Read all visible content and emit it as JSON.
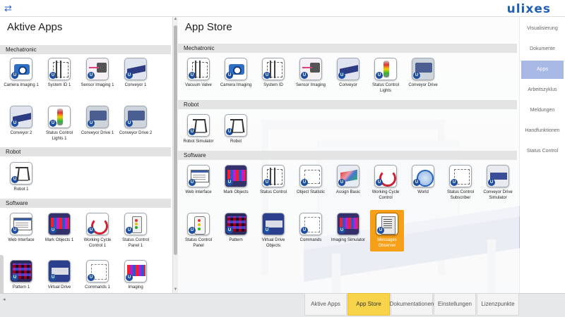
{
  "logo": "ulixes",
  "left_panel": {
    "title": "Aktive Apps",
    "sections": [
      {
        "header": "Mechatronic",
        "items": [
          {
            "label": "Camera Imaging 1",
            "icon": "camera-icon"
          },
          {
            "label": "System ID 1",
            "icon": "system-icon"
          },
          {
            "label": "Sensor Imaging 1",
            "icon": "sensor-icon"
          },
          {
            "label": "Conveyor 1",
            "icon": "conveyor-icon"
          },
          {
            "label": "Conveyor 2",
            "icon": "conveyor-icon"
          },
          {
            "label": "Status Control Lights 1",
            "icon": "lights-icon"
          },
          {
            "label": "Conveyor Drive 1",
            "icon": "drive-icon"
          },
          {
            "label": "Conveyor Drive 2",
            "icon": "drive-icon"
          }
        ]
      },
      {
        "header": "Robot",
        "items": [
          {
            "label": "Robot 1",
            "icon": "robot-icon"
          }
        ]
      },
      {
        "header": "Software",
        "items": [
          {
            "label": "Web Interface",
            "icon": "web-icon"
          },
          {
            "label": "Mark Objects 1",
            "icon": "mark-icon"
          },
          {
            "label": "Working Cycle Control 1",
            "icon": "cycle-icon"
          },
          {
            "label": "Status Control Panel 1",
            "icon": "panel-icon"
          },
          {
            "label": "Pattern 1",
            "icon": "pattern-icon"
          },
          {
            "label": "Virtual Drive",
            "icon": "vdrive-icon"
          },
          {
            "label": "Commands 1",
            "icon": "commands-icon"
          },
          {
            "label": "Imaging",
            "icon": "imaging-icon"
          }
        ]
      }
    ]
  },
  "right_panel": {
    "title": "App Store",
    "sections": [
      {
        "header": "Mechatronic",
        "items": [
          {
            "label": "Vacuum Valve",
            "icon": "valve-icon"
          },
          {
            "label": "Camera Imaging",
            "icon": "camera-icon"
          },
          {
            "label": "System ID",
            "icon": "system-icon"
          },
          {
            "label": "Sensor Imaging",
            "icon": "sensor-icon"
          },
          {
            "label": "Conveyor",
            "icon": "conveyor-icon"
          },
          {
            "label": "Status Control Lights",
            "icon": "lights-icon"
          },
          {
            "label": "Conveyor Drive",
            "icon": "drive-icon"
          }
        ]
      },
      {
        "header": "Robot",
        "items": [
          {
            "label": "Robot Simulator",
            "icon": "robot-icon"
          },
          {
            "label": "Robot",
            "icon": "robot-icon"
          }
        ]
      },
      {
        "header": "Software",
        "items": [
          {
            "label": "Web Interface",
            "icon": "web-icon"
          },
          {
            "label": "Mark Objects",
            "icon": "mark-icon"
          },
          {
            "label": "Status Control",
            "icon": "status-icon"
          },
          {
            "label": "Object Statistic",
            "icon": "statistic-icon"
          },
          {
            "label": "Assign Basic",
            "icon": "assign-icon"
          },
          {
            "label": "Working Cycle Control",
            "icon": "cycle-icon"
          },
          {
            "label": "World",
            "icon": "world-icon"
          },
          {
            "label": "Status Control Subscriber",
            "icon": "subscriber-icon"
          },
          {
            "label": "Conveyor Drive Simulator",
            "icon": "conveyor-sim-icon"
          },
          {
            "label": "Status Control Panel",
            "icon": "panel-icon"
          },
          {
            "label": "Pattern",
            "icon": "pattern-icon"
          },
          {
            "label": "Virtual Drive Objects",
            "icon": "vdrive-icon"
          },
          {
            "label": "Commands",
            "icon": "commands-icon"
          },
          {
            "label": "Imaging Simulator",
            "icon": "imaging-icon"
          },
          {
            "label": "Messages Observer",
            "icon": "messages-icon"
          }
        ]
      }
    ]
  },
  "nav": {
    "items": [
      {
        "label": "Visualisierung"
      },
      {
        "label": "Dokumente"
      },
      {
        "label": "Apps"
      },
      {
        "label": "Arbeitszyklus"
      },
      {
        "label": "Meldungen"
      },
      {
        "label": "Handfunktionen"
      },
      {
        "label": "Status Control"
      }
    ]
  },
  "bottom_tabs": [
    {
      "label": "Aktive Apps"
    },
    {
      "label": "App Store"
    },
    {
      "label": "Dokumentationen"
    },
    {
      "label": "Einstellungen"
    },
    {
      "label": "Lizenzpunkte"
    }
  ],
  "colors": {
    "accent": "#f6a019",
    "nav_active": "#a9b9e6",
    "tab_active": "#f7d44c",
    "brand": "#1f5fb5"
  }
}
